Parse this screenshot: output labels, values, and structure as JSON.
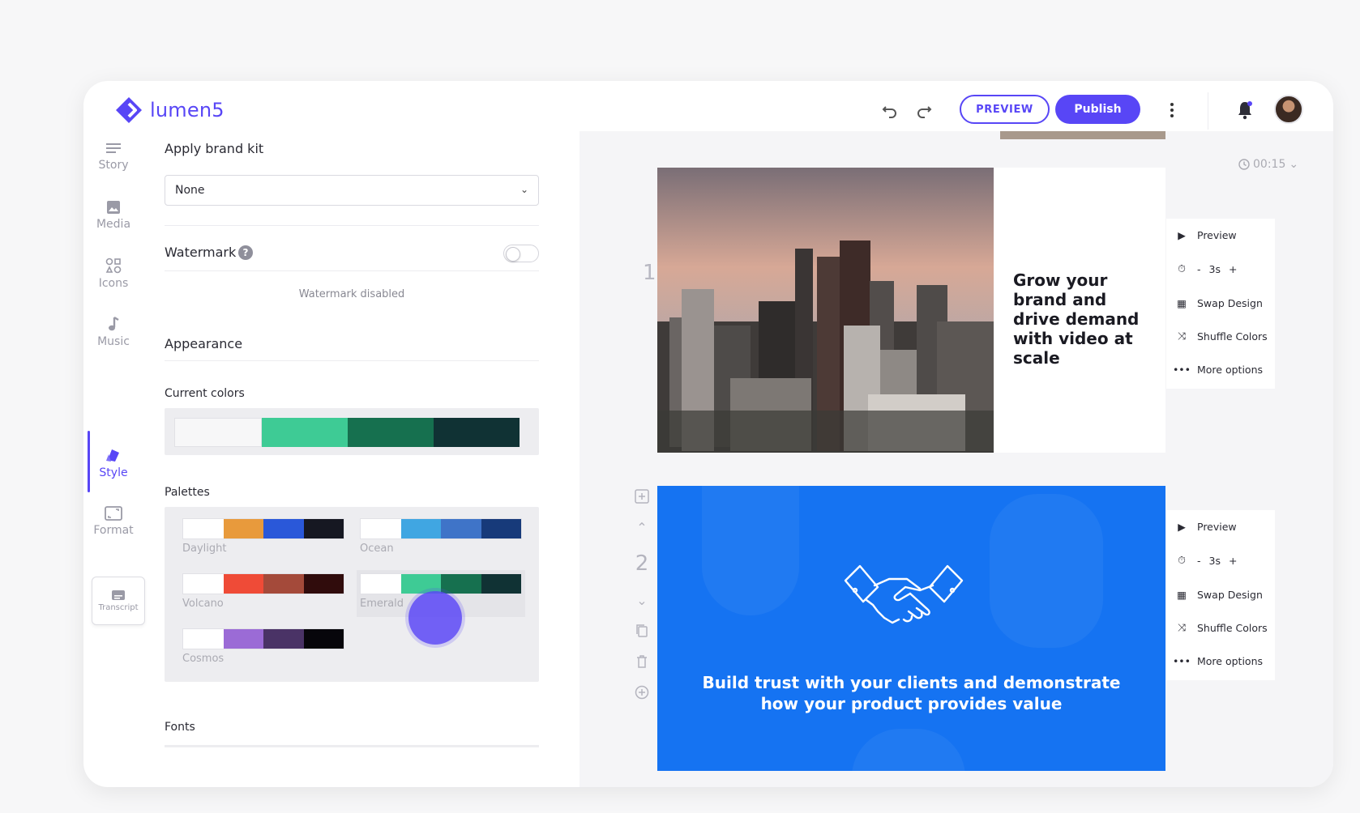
{
  "header": {
    "logo_text": "lumen5",
    "preview_label": "PREVIEW",
    "publish_label": "Publish",
    "brand_color": "#5846f6"
  },
  "rail": {
    "items": [
      {
        "label": "Story",
        "icon": "story-lines-icon"
      },
      {
        "label": "Media",
        "icon": "image-icon"
      },
      {
        "label": "Icons",
        "icon": "shapes-icon"
      },
      {
        "label": "Music",
        "icon": "music-note-icon"
      },
      {
        "label": "Style",
        "icon": "style-palette-icon",
        "active": true
      },
      {
        "label": "Format",
        "icon": "aspect-ratio-icon"
      }
    ],
    "transcript_label": "Transcript"
  },
  "panel": {
    "brand_kit_label": "Apply brand kit",
    "brand_kit_value": "None",
    "watermark_label": "Watermark",
    "watermark_help": "?",
    "watermark_enabled": false,
    "watermark_status": "Watermark disabled",
    "appearance_label": "Appearance",
    "current_colors_label": "Current colors",
    "current_colors": [
      "#f7f7f8",
      "#3ecb95",
      "#16704f",
      "#103234"
    ],
    "palettes_label": "Palettes",
    "palettes": [
      {
        "name": "Daylight",
        "colors": [
          "#ffffff",
          "#e89a3c",
          "#2a58d9",
          "#161822"
        ]
      },
      {
        "name": "Ocean",
        "colors": [
          "#ffffff",
          "#40a6e2",
          "#3f74c8",
          "#173a7a"
        ]
      },
      {
        "name": "Volcano",
        "colors": [
          "#ffffff",
          "#ef4b37",
          "#a44a3a",
          "#300c0c"
        ]
      },
      {
        "name": "Emerald",
        "colors": [
          "#ffffff",
          "#3ecb95",
          "#16704f",
          "#103234"
        ],
        "selected": true
      },
      {
        "name": "Cosmos",
        "colors": [
          "#ffffff",
          "#9b6bd6",
          "#4a3366",
          "#07060b"
        ]
      }
    ],
    "fonts_label": "Fonts"
  },
  "canvas": {
    "duration": "00:15",
    "scenes": [
      {
        "number": "1",
        "text": "Grow your brand and drive demand with video at scale",
        "options": {
          "preview": "Preview",
          "minus": "-",
          "duration": "3s",
          "plus": "+",
          "swap": "Swap Design",
          "shuffle": "Shuffle Colors",
          "more": "More options"
        }
      },
      {
        "number": "2",
        "text": "Build trust with your clients and demonstrate how your product provides value",
        "background": "#1573f2",
        "options": {
          "preview": "Preview",
          "minus": "-",
          "duration": "3s",
          "plus": "+",
          "swap": "Swap Design",
          "shuffle": "Shuffle Colors",
          "more": "More options"
        }
      }
    ]
  }
}
